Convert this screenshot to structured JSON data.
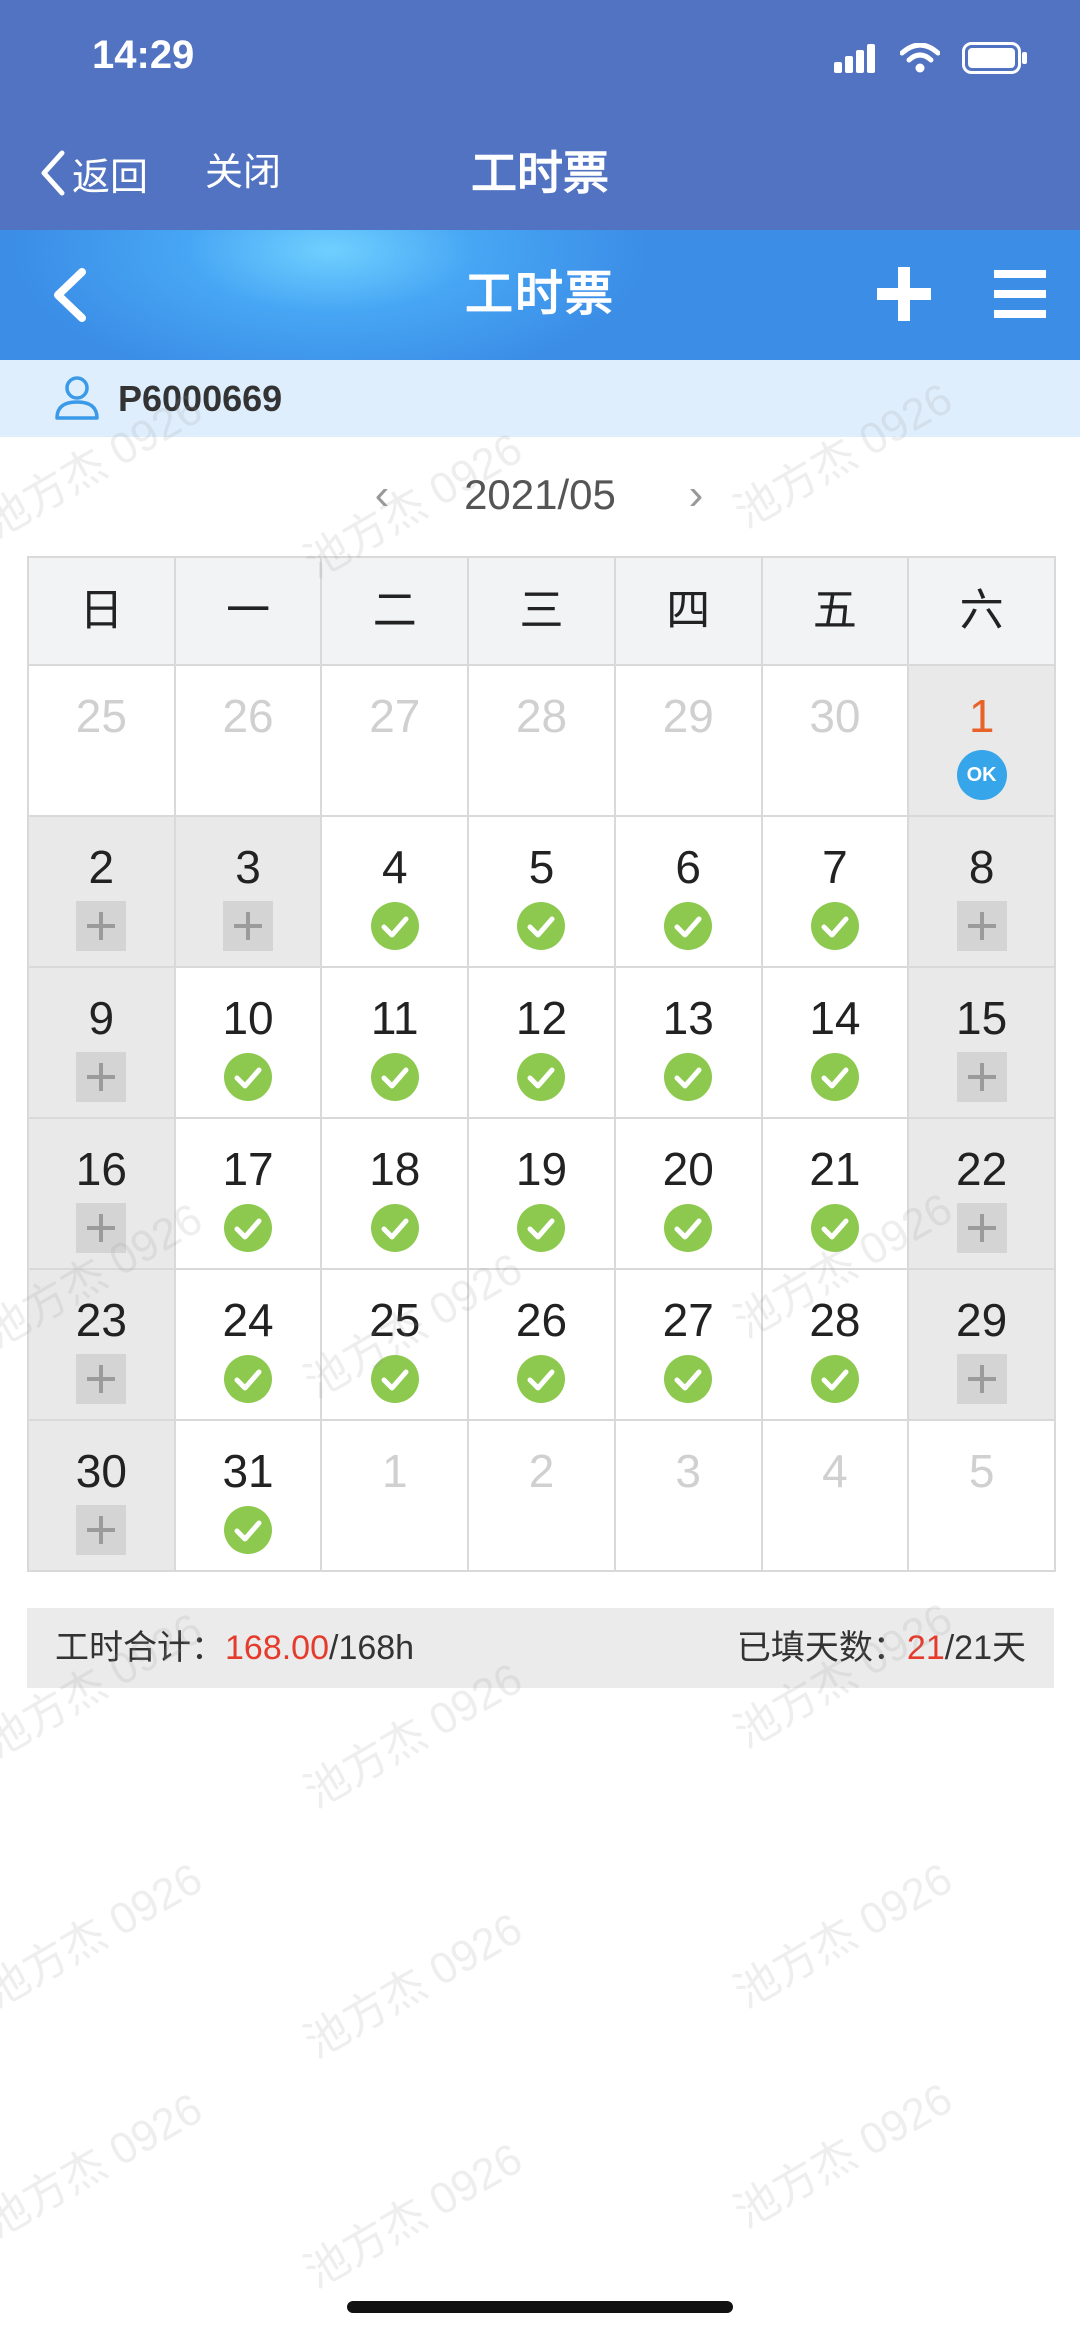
{
  "status_bar": {
    "time": "14:29"
  },
  "navbar": {
    "back_label": "返回",
    "close_label": "关闭",
    "title": "工时票"
  },
  "app_header": {
    "title": "工时票"
  },
  "user": {
    "id": "P6000669"
  },
  "month": {
    "prev": "‹",
    "label": "2021/05",
    "next": "›"
  },
  "calendar": {
    "weekdays": [
      "日",
      "一",
      "二",
      "三",
      "四",
      "五",
      "六"
    ],
    "rows": [
      [
        {
          "day": "25",
          "state": "muted"
        },
        {
          "day": "26",
          "state": "muted"
        },
        {
          "day": "27",
          "state": "muted"
        },
        {
          "day": "28",
          "state": "muted"
        },
        {
          "day": "29",
          "state": "muted"
        },
        {
          "day": "30",
          "state": "muted"
        },
        {
          "day": "1",
          "state": "ok",
          "weekend": true,
          "badge": "OK"
        }
      ],
      [
        {
          "day": "2",
          "state": "add",
          "weekend": true
        },
        {
          "day": "3",
          "state": "add",
          "weekend": true
        },
        {
          "day": "4",
          "state": "done"
        },
        {
          "day": "5",
          "state": "done"
        },
        {
          "day": "6",
          "state": "done"
        },
        {
          "day": "7",
          "state": "done"
        },
        {
          "day": "8",
          "state": "add",
          "weekend": true
        }
      ],
      [
        {
          "day": "9",
          "state": "add",
          "weekend": true
        },
        {
          "day": "10",
          "state": "done"
        },
        {
          "day": "11",
          "state": "done"
        },
        {
          "day": "12",
          "state": "done"
        },
        {
          "day": "13",
          "state": "done"
        },
        {
          "day": "14",
          "state": "done"
        },
        {
          "day": "15",
          "state": "add",
          "weekend": true
        }
      ],
      [
        {
          "day": "16",
          "state": "add",
          "weekend": true
        },
        {
          "day": "17",
          "state": "done"
        },
        {
          "day": "18",
          "state": "done"
        },
        {
          "day": "19",
          "state": "done"
        },
        {
          "day": "20",
          "state": "done"
        },
        {
          "day": "21",
          "state": "done"
        },
        {
          "day": "22",
          "state": "add",
          "weekend": true
        }
      ],
      [
        {
          "day": "23",
          "state": "add",
          "weekend": true
        },
        {
          "day": "24",
          "state": "done"
        },
        {
          "day": "25",
          "state": "done"
        },
        {
          "day": "26",
          "state": "done"
        },
        {
          "day": "27",
          "state": "done"
        },
        {
          "day": "28",
          "state": "done"
        },
        {
          "day": "29",
          "state": "add",
          "weekend": true
        }
      ],
      [
        {
          "day": "30",
          "state": "add",
          "weekend": true
        },
        {
          "day": "31",
          "state": "done"
        },
        {
          "day": "1",
          "state": "muted"
        },
        {
          "day": "2",
          "state": "muted"
        },
        {
          "day": "3",
          "state": "muted"
        },
        {
          "day": "4",
          "state": "muted"
        },
        {
          "day": "5",
          "state": "muted"
        }
      ]
    ]
  },
  "summary": {
    "hours_label": "工时合计：",
    "hours_value": "168.00",
    "hours_total": "/168h",
    "days_label": "已填天数：",
    "days_value": "21",
    "days_total": "/21天"
  },
  "watermark": "池方杰 0926",
  "colors": {
    "nav_bg": "#5273c2",
    "header_blue": "#3b8de6",
    "user_bar_bg": "#dfeefc",
    "check_green": "#8cc94e",
    "ok_blue": "#36a5ea",
    "accent_red": "#e53b2c",
    "weekend_bg": "#e9e9e9"
  }
}
